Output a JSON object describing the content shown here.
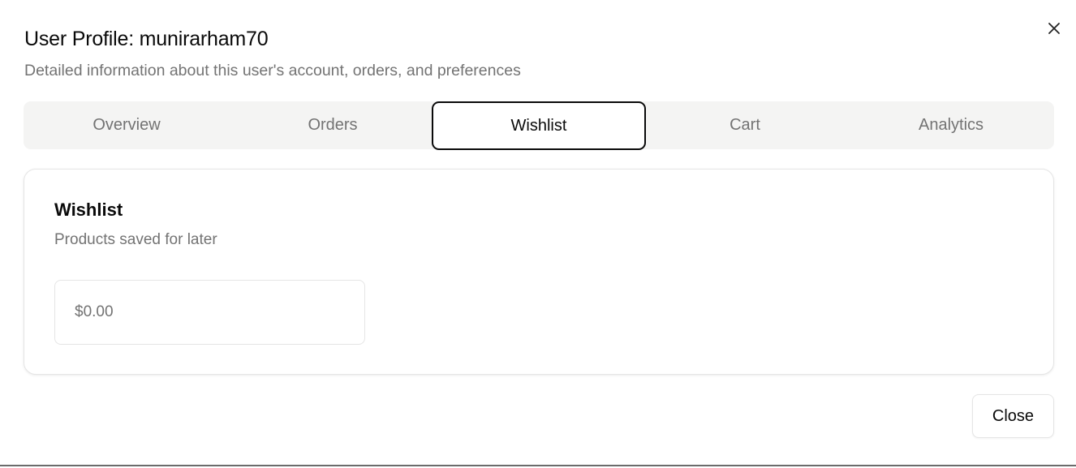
{
  "dialog": {
    "title": "User Profile: munirarham70",
    "subtitle": "Detailed information about this user's account, orders, and preferences",
    "close_icon": "close-icon"
  },
  "tabs": [
    {
      "label": "Overview",
      "active": false
    },
    {
      "label": "Orders",
      "active": false
    },
    {
      "label": "Wishlist",
      "active": true
    },
    {
      "label": "Cart",
      "active": false
    },
    {
      "label": "Analytics",
      "active": false
    }
  ],
  "wishlist_card": {
    "title": "Wishlist",
    "description": "Products saved for later",
    "total": "$0.00"
  },
  "footer": {
    "close_label": "Close"
  }
}
